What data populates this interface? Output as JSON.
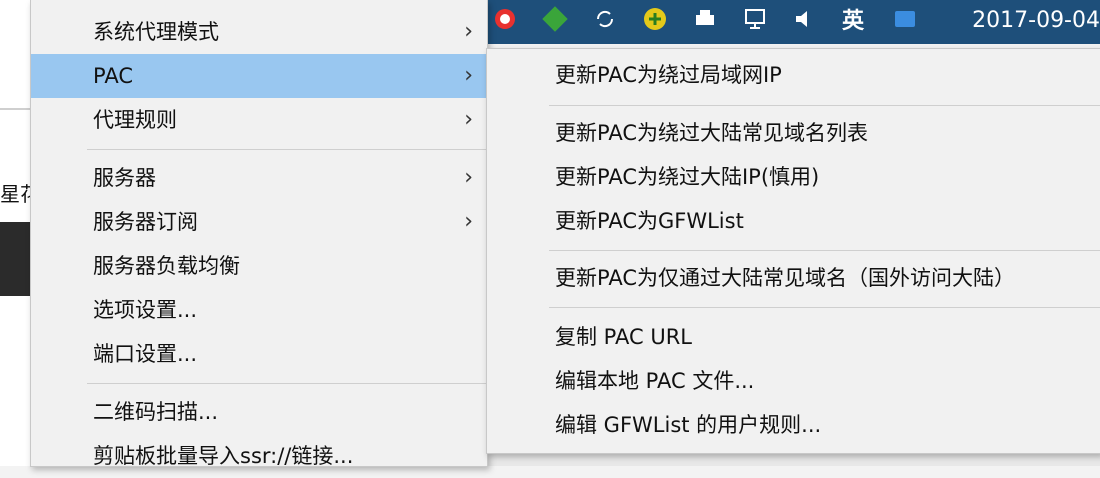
{
  "taskbar": {
    "time": "2017-09-04",
    "input_indicator": "英",
    "icons": [
      "weibo-icon",
      "app-icon",
      "refresh-icon",
      "plus-icon",
      "printer-icon",
      "network-icon",
      "volume-icon"
    ]
  },
  "background": {
    "left_text": "星花"
  },
  "main_menu": {
    "items": [
      {
        "label": "系统代理模式",
        "has_submenu": true
      },
      {
        "label": "PAC",
        "has_submenu": true,
        "highlighted": true
      },
      {
        "label": "代理规则",
        "has_submenu": true
      },
      {
        "label": "服务器",
        "has_submenu": true
      },
      {
        "label": "服务器订阅",
        "has_submenu": true
      },
      {
        "label": "服务器负载均衡",
        "has_submenu": false
      },
      {
        "label": "选项设置...",
        "has_submenu": false
      },
      {
        "label": "端口设置...",
        "has_submenu": false
      },
      {
        "label": "二维码扫描...",
        "has_submenu": false
      },
      {
        "label": "剪贴板批量导入ssr://链接...",
        "has_submenu": false
      }
    ],
    "submenu_arrow": "›"
  },
  "pac_submenu": {
    "items": [
      {
        "label": "更新PAC为绕过局域网IP"
      },
      {
        "label": "更新PAC为绕过大陆常见域名列表"
      },
      {
        "label": "更新PAC为绕过大陆IP(慎用)"
      },
      {
        "label": "更新PAC为GFWList"
      },
      {
        "label": "更新PAC为仅通过大陆常见域名（国外访问大陆）"
      },
      {
        "label": "复制 PAC URL"
      },
      {
        "label": "编辑本地 PAC 文件..."
      },
      {
        "label": "编辑 GFWList 的用户规则..."
      }
    ]
  },
  "colors": {
    "highlight": "#99c7f0",
    "menu_bg": "#f1f1f1",
    "taskbar": "#1e4f7a"
  }
}
